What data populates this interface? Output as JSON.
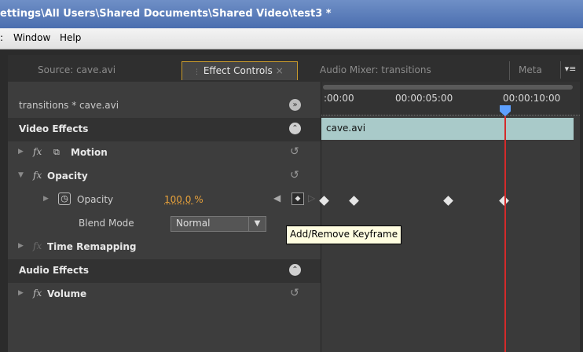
{
  "title": "ettings\\All Users\\Shared Documents\\Shared Video\\test3 *",
  "menu": {
    "partial": ":",
    "window": "Window",
    "help": "Help"
  },
  "tabs": [
    {
      "label": "Source: cave.avi"
    },
    {
      "label": "Effect Controls",
      "close": "×"
    },
    {
      "label": "Audio Mixer: transitions"
    },
    {
      "label": "Meta"
    }
  ],
  "tab_menu_glyph": "▾≡",
  "sequence": {
    "label": "transitions * cave.avi",
    "nav_glyph": "»"
  },
  "timecodes": [
    ":00:00",
    "00:00:05:00",
    "00:00:10:00"
  ],
  "clip_name": "cave.avi",
  "video_effects": {
    "label": "Video Effects",
    "motion": {
      "label": "Motion"
    },
    "opacity": {
      "label": "Opacity",
      "property": {
        "label": "Opacity",
        "value": "100.0",
        "unit": "%"
      },
      "blend_mode": {
        "label": "Blend Mode",
        "value": "Normal"
      }
    },
    "time_remapping": {
      "label": "Time Remapping"
    }
  },
  "audio_effects": {
    "label": "Audio Effects",
    "volume": {
      "label": "Volume"
    }
  },
  "fx_glyph": "fx",
  "reset_glyph": "↺",
  "collapse_glyph": "⌃",
  "tooltip": "Add/Remove Keyframe",
  "colors": {
    "accent": "#c99b2c",
    "playhead": "#d42a2a",
    "clip": "#a9cac9",
    "value": "#e8a23b"
  }
}
